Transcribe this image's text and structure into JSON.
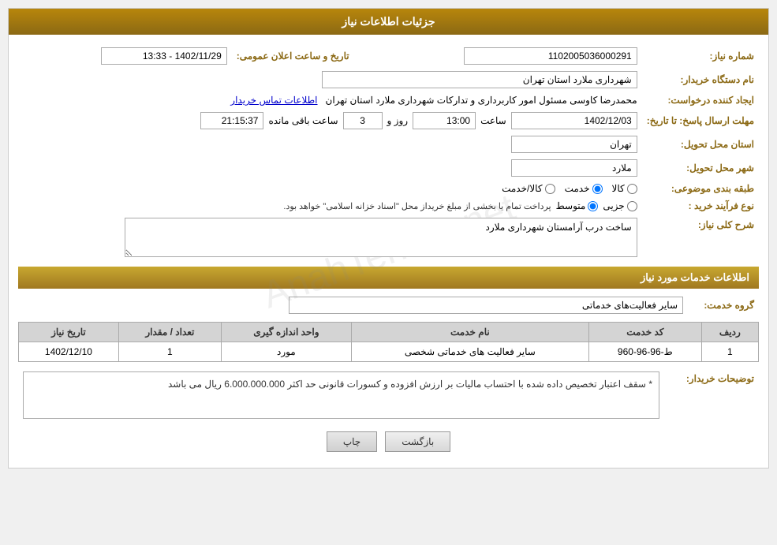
{
  "page": {
    "title": "جزئیات اطلاعات نیاز",
    "watermark": "AnahTender.net"
  },
  "header": {
    "label": "جزئیات اطلاعات نیاز"
  },
  "fields": {
    "need_number_label": "شماره نیاز:",
    "need_number_value": "1102005036000291",
    "buyer_org_label": "نام دستگاه خریدار:",
    "buyer_org_value": "شهرداری ملارد استان تهران",
    "announce_datetime_label": "تاریخ و ساعت اعلان عمومی:",
    "announce_datetime_value": "1402/11/29 - 13:33",
    "creator_label": "ایجاد کننده درخواست:",
    "creator_value": "محمدرضا کاوسی مسئول امور کاربرداری و تدارکات  شهرداری ملارد استان تهران",
    "contact_link": "اطلاعات تماس خریدار",
    "deadline_label": "مهلت ارسال پاسخ: تا تاریخ:",
    "deadline_date": "1402/12/03",
    "deadline_time_label": "ساعت",
    "deadline_time": "13:00",
    "deadline_day_label": "روز و",
    "deadline_days": "3",
    "deadline_remain_label": "ساعت باقی مانده",
    "deadline_remain_time": "21:15:37",
    "province_label": "استان محل تحویل:",
    "province_value": "تهران",
    "city_label": "شهر محل تحویل:",
    "city_value": "ملارد",
    "category_label": "طبقه بندی موضوعی:",
    "category_options": [
      "کالا",
      "خدمت",
      "کالا/خدمت"
    ],
    "category_selected": "خدمت",
    "purchase_type_label": "نوع فرآیند خرید :",
    "purchase_type_options": [
      "جزیی",
      "متوسط"
    ],
    "purchase_type_note": "پرداخت تمام یا بخشی از مبلغ خریداز محل \"اسناد خزانه اسلامی\" خواهد بود.",
    "general_desc_label": "شرح کلی نیاز:",
    "general_desc_value": "ساخت درب آرامستان شهرداری ملارد"
  },
  "services_section": {
    "title": "اطلاعات خدمات مورد نیاز",
    "service_group_label": "گروه خدمت:",
    "service_group_value": "سایر فعالیت‌های خدماتی",
    "table": {
      "columns": [
        "ردیف",
        "کد خدمت",
        "نام خدمت",
        "واحد اندازه گیری",
        "تعداد / مقدار",
        "تاریخ نیاز"
      ],
      "rows": [
        {
          "row": "1",
          "code": "ط-96-96-960",
          "name": "سایر فعالیت های خدماتی شخصی",
          "unit": "مورد",
          "quantity": "1",
          "date": "1402/12/10"
        }
      ]
    }
  },
  "buyer_notes_label": "توضیحات خریدار:",
  "buyer_notes_value": "* سقف اعتبار تخصیص داده شده با احتساب مالیات بر ارزش افزوده و کسورات قانونی حد اکثر 6.000.000.000 ریال می باشد",
  "buttons": {
    "print": "چاپ",
    "back": "بازگشت"
  }
}
